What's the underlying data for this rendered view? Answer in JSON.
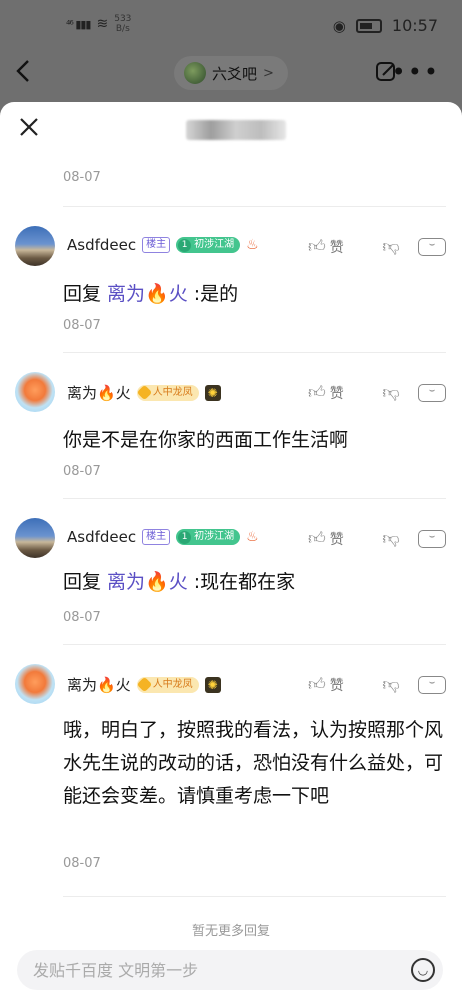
{
  "status": {
    "signal": "⁴⁶ ▮▮▮",
    "speed_value": "533",
    "speed_unit": "B/s",
    "time": "10:57"
  },
  "nav": {
    "forum_name": "六爻吧"
  },
  "thread": {
    "first_date": "08-07",
    "replies": [
      {
        "username": "Asdfdeec",
        "host_badge": "楼主",
        "level_num": "1",
        "level_title": "初涉江湖",
        "like_label": "赞",
        "content_prefix": "回复 ",
        "mention": "离为🔥火",
        "content_text": " :是的",
        "date": "08-07"
      },
      {
        "username": "离为🔥火",
        "level_num": "",
        "level_title": "人中龙凤",
        "like_label": "赞",
        "content_text": "你是不是在你家的西面工作生活啊",
        "date": "08-07"
      },
      {
        "username": "Asdfdeec",
        "host_badge": "楼主",
        "level_num": "1",
        "level_title": "初涉江湖",
        "like_label": "赞",
        "content_prefix": "回复 ",
        "mention": "离为🔥火",
        "content_text": " :现在都在家",
        "date": "08-07"
      },
      {
        "username": "离为🔥火",
        "level_num": "",
        "level_title": "人中龙凤",
        "like_label": "赞",
        "content_text": "哦，明白了，按照我的看法，认为按照那个风水先生说的改动的话，恐怕没有什么益处，可能还会变差。请慎重考虑一下吧",
        "date": "08-07"
      }
    ],
    "no_more": "暂无更多回复"
  },
  "composer": {
    "placeholder": "发贴千百度 文明第一步"
  },
  "colors": {
    "accent": "#5a4fc4",
    "level_green": "#43c58e",
    "level_gold": "#f5b323"
  }
}
